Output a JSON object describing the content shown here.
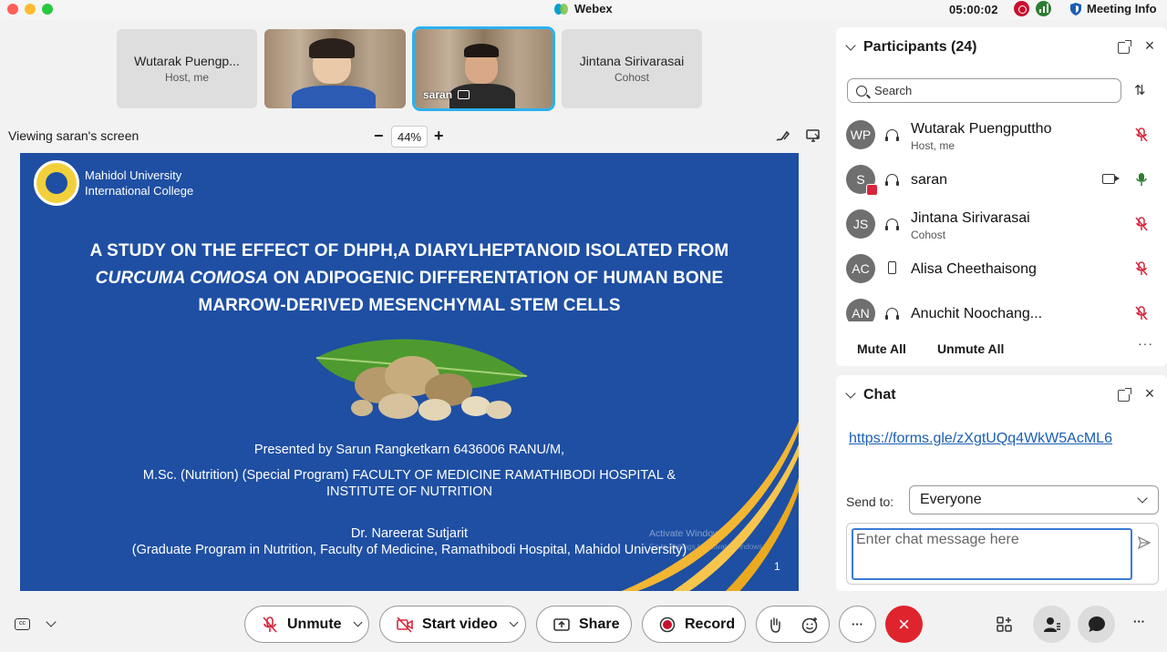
{
  "titlebar": {
    "app_title": "Webex",
    "timer": "05:00:02",
    "meeting_info": "Meeting Info"
  },
  "thumbnails": [
    {
      "name": "Wutarak Puengp...",
      "role": "Host, me"
    },
    {
      "name": "",
      "role": ""
    },
    {
      "name": "saran",
      "role": ""
    },
    {
      "name": "Jintana Sirivarasai",
      "role": "Cohost"
    }
  ],
  "stage": {
    "viewing_label": "Viewing saran's screen",
    "zoom_minus": "−",
    "zoom_value": "44%",
    "zoom_plus": "+"
  },
  "slide": {
    "university_line1": "Mahidol University",
    "university_line2": "International College",
    "title_line1": "A STUDY ON THE EFFECT OF DHPH,A DIARYLHEPTANOID ISOLATED FROM",
    "title_line2_italic": "CURCUMA COMOSA",
    "title_line2_rest": " ON ADIPOGENIC DIFFERENTATION OF HUMAN BONE",
    "title_line3": "MARROW-DERIVED MESENCHYMAL STEM CELLS",
    "presented_by": "Presented by Sarun Rangketkarn 6436006 RANU/M,",
    "program_line1": "M.Sc. (Nutrition) (Special Program) FACULTY OF MEDICINE RAMATHIBODI HOSPITAL &",
    "program_line2": "INSTITUTE OF NUTRITION",
    "advisor": "Dr. Nareerat Sutjarit",
    "advisor_affiliation": "(Graduate Program in Nutrition, Faculty of Medicine, Ramathibodi Hospital, Mahidol University)",
    "watermark_line1": "Activate Windows",
    "watermark_line2": "Go to Settings to activate Windows.",
    "page_number": "1",
    "colors": {
      "background": "#1e4fa3",
      "swoosh": "#f2b632"
    }
  },
  "participants_panel": {
    "title": "Participants (24)",
    "search_placeholder": "Search",
    "participants": [
      {
        "initials": "WP",
        "name": "Wutarak Puengputtho",
        "role": "Host, me",
        "device": "headset-icon",
        "mic": "muted"
      },
      {
        "initials": "S",
        "name": "saran",
        "role": "",
        "device": "headset-icon",
        "mic": "on",
        "video": true,
        "sharing": true
      },
      {
        "initials": "JS",
        "name": "Jintana Sirivarasai",
        "role": "Cohost",
        "device": "headset-icon",
        "mic": "muted"
      },
      {
        "initials": "AC",
        "name": "Alisa Cheethaisong",
        "role": "",
        "device": "phone-icon",
        "mic": "muted"
      },
      {
        "initials": "AN",
        "name": "Anuchit Noochang...",
        "role": "",
        "device": "headset-icon",
        "mic": "muted"
      }
    ],
    "mute_all": "Mute All",
    "unmute_all": "Unmute All",
    "more": "···"
  },
  "chat_panel": {
    "title": "Chat",
    "message_link": "https://forms.gle/zXgtUQq4WkW5AcML6",
    "send_to_label": "Send to:",
    "send_to_value": "Everyone",
    "input_placeholder": "Enter chat message here"
  },
  "toolbar": {
    "unmute": "Unmute",
    "start_video": "Start video",
    "share": "Share",
    "record": "Record",
    "more": "···",
    "leave_icon": "×",
    "colors": {
      "leave": "#e0242d",
      "mic_off": "#d7263d",
      "record_dot": "#c8102e"
    }
  }
}
